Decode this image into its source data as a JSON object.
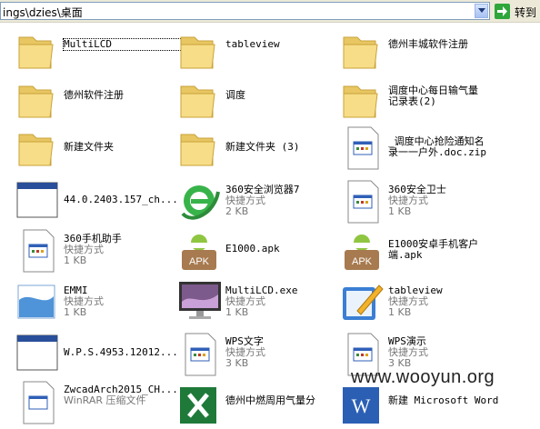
{
  "address_bar": {
    "path": "ings\\dzies\\桌面",
    "go_label": "转到"
  },
  "items": [
    {
      "name": "MultiLCD",
      "type": "folder",
      "selected": true
    },
    {
      "name": "tableview",
      "type": "folder"
    },
    {
      "name": "德州丰城软件注册",
      "type": "folder"
    },
    {
      "name": "德州软件注册",
      "type": "folder"
    },
    {
      "name": "调度",
      "type": "folder"
    },
    {
      "name": "调度中心每日输气量\n记录表(2)",
      "type": "folder"
    },
    {
      "name": "新建文件夹",
      "type": "folder"
    },
    {
      "name": "新建文件夹 (3)",
      "type": "folder"
    },
    {
      "name": "_调度中心抢险通知名\n录一一户外.doc.zip",
      "type": "file"
    },
    {
      "name": "44.0.2403.157_ch...",
      "type": "window"
    },
    {
      "name": "360安全浏览器7",
      "sub1": "快捷方式",
      "sub2": "2 KB",
      "type": "ie"
    },
    {
      "name": "360安全卫士",
      "sub1": "快捷方式",
      "sub2": "1 KB",
      "type": "shortcut"
    },
    {
      "name": "360手机助手",
      "sub1": "快捷方式",
      "sub2": "1 KB",
      "type": "shortcut"
    },
    {
      "name": "E1000.apk",
      "type": "apk"
    },
    {
      "name": "E1000安卓手机客户\n端.apk",
      "type": "apk"
    },
    {
      "name": "EMMI",
      "sub1": "快捷方式",
      "sub2": "1 KB",
      "type": "emmi"
    },
    {
      "name": "MultiLCD.exe",
      "sub1": "快捷方式",
      "sub2": "1 KB",
      "type": "monitor"
    },
    {
      "name": "tableview",
      "sub1": "快捷方式",
      "sub2": "1 KB",
      "type": "notepad"
    },
    {
      "name": "W.P.S.4953.12012...",
      "type": "window"
    },
    {
      "name": "WPS文字",
      "sub1": "快捷方式",
      "sub2": "3 KB",
      "type": "shortcut"
    },
    {
      "name": "WPS演示",
      "sub1": "快捷方式",
      "sub2": "3 KB",
      "type": "shortcut"
    },
    {
      "name": "ZwcadArch2015_CH...",
      "sub1": "WinRAR 压缩文件",
      "type": "shortcut"
    },
    {
      "name": "德州中燃周用气量分",
      "type": "excel"
    },
    {
      "name": "新建 Microsoft Word",
      "type": "word"
    }
  ],
  "watermark": "www.wooyun.org"
}
